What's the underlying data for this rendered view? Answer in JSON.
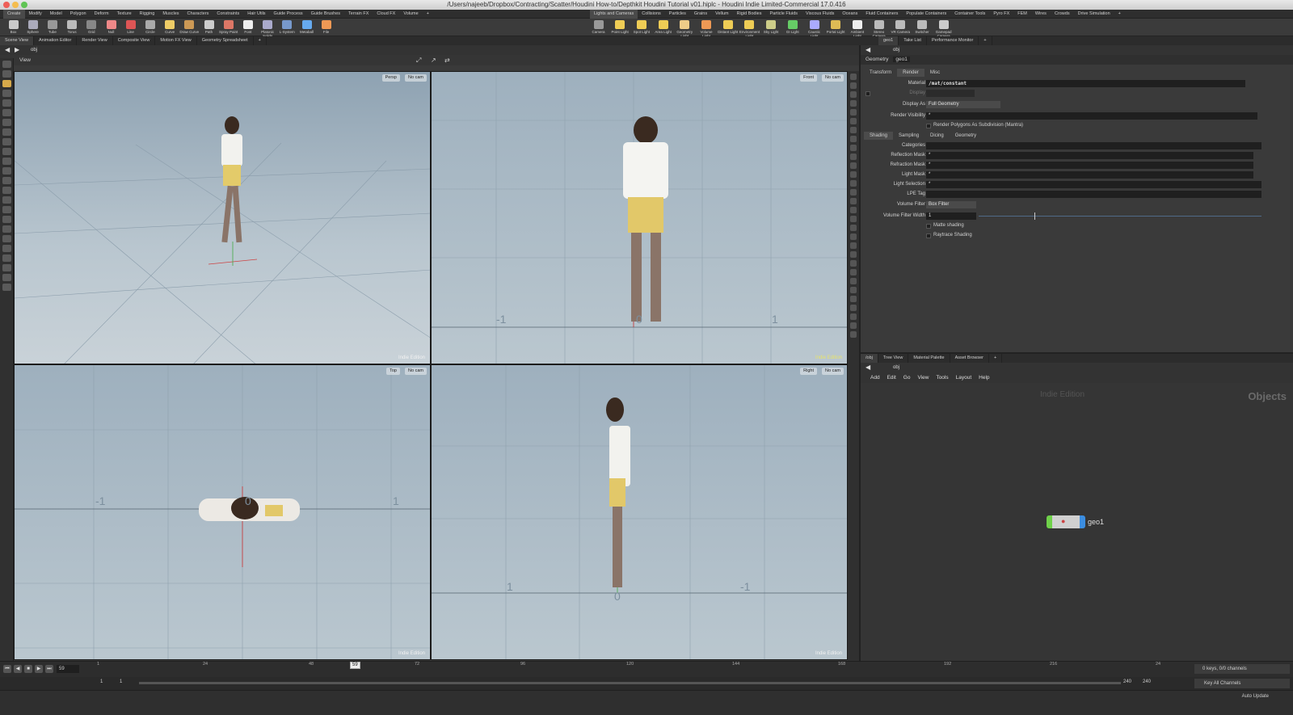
{
  "window": {
    "title": "/Users/najeeb/Dropbox/Contracting/Scatter/Houdini How-to/Depthkit Houdini Tutorial v01.hiplc - Houdini Indie Limited-Commercial 17.0.416"
  },
  "shelf_tabs_left": [
    "Create",
    "Modify",
    "Model",
    "Polygon",
    "Deform",
    "Texture",
    "Rigging",
    "Muscles",
    "Characters",
    "Constraints",
    "Hair Utils",
    "Guide Process",
    "Guide Brushes",
    "Terrain FX",
    "Cloud FX",
    "Volume",
    "+"
  ],
  "shelf_tabs_right": [
    "Lights and Cameras",
    "Collisions",
    "Particles",
    "Grains",
    "Vellum",
    "Rigid Bodies",
    "Particle Fluids",
    "Viscous Fluids",
    "Oceans",
    "Fluid Containers",
    "Populate Containers",
    "Container Tools",
    "Pyro FX",
    "FEM",
    "Wires",
    "Crowds",
    "Drive Simulation",
    "+"
  ],
  "shelf_tools_left": [
    "Box",
    "Sphere",
    "Tube",
    "Torus",
    "Grid",
    "Null",
    "Line",
    "Circle",
    "Curve",
    "Draw Curve",
    "Path",
    "Spray Paint",
    "Font",
    "Platonic Solids",
    "L-System",
    "Metaball",
    "File"
  ],
  "shelf_tools_right": [
    "Camera",
    "Point Light",
    "Spot Light",
    "Area Light",
    "Geometry Light",
    "Volume Light",
    "Distant Light",
    "Environment Light",
    "Sky Light",
    "GI Light",
    "Caustic Light",
    "Portal Light",
    "Ambient Light",
    "Stereo Camera",
    "VR Camera",
    "Switcher",
    "Gamepad Camera"
  ],
  "pane_tabs_left": [
    "Scene View",
    "Animation Editor",
    "Render View",
    "Composite View",
    "Motion FX View",
    "Geometry Spreadsheet",
    "+"
  ],
  "pane_tabs_right": [
    "geo1",
    "Take List",
    "Performance Monitor",
    "+"
  ],
  "scene_path": "obj",
  "view_label": "View",
  "viewports": {
    "persp": {
      "view": "Persp",
      "cam": "No cam",
      "edition": "Indie Edition"
    },
    "front": {
      "view": "Front",
      "cam": "No cam",
      "edition": "Indie Edition",
      "axis_labels": [
        "-1",
        "0",
        "1"
      ]
    },
    "top": {
      "view": "Top",
      "cam": "No cam",
      "edition": "Indie Edition",
      "axis_labels": [
        "-1",
        "0",
        "1"
      ]
    },
    "right": {
      "view": "Right",
      "cam": "No cam",
      "edition": "Indie Edition",
      "axis_labels": [
        "1",
        "0",
        "-1"
      ]
    }
  },
  "params": {
    "path": "obj",
    "node_type": "Geometry",
    "node_name": "geo1",
    "tabs": [
      "Transform",
      "Render",
      "Misc"
    ],
    "active_tab": "Render",
    "material_label": "Material",
    "material_value": "/mat/constant",
    "display_label": "Display",
    "display_as_label": "Display As",
    "display_as_value": "Full Geometry",
    "render_visibility_label": "Render Visibility",
    "render_visibility_value": "*",
    "render_polygons_label": "Render Polygons As Subdivision (Mantra)",
    "subtabs": [
      "Shading",
      "Sampling",
      "Dicing",
      "Geometry"
    ],
    "categories_label": "Categories",
    "reflection_mask_label": "Reflection Mask",
    "reflection_mask_value": "*",
    "refraction_mask_label": "Refraction Mask",
    "refraction_mask_value": "*",
    "light_mask_label": "Light Mask",
    "light_mask_value": "*",
    "light_selection_label": "Light Selection",
    "light_selection_value": "*",
    "lpe_tag_label": "LPE Tag",
    "volume_filter_label": "Volume Filter",
    "volume_filter_value": "Box Filter",
    "volume_filter_width_label": "Volume Filter Width",
    "volume_filter_width_value": "1",
    "matte_shading_label": "Matte shading",
    "raytrace_shading_label": "Raytrace Shading"
  },
  "network": {
    "tabs": [
      "/obj",
      "Tree View",
      "Material Palette",
      "Asset Browser",
      "+"
    ],
    "path": "obj",
    "menu": [
      "Add",
      "Edit",
      "Go",
      "View",
      "Tools",
      "Layout",
      "Help"
    ],
    "watermark": "Indie Edition",
    "context_label": "Objects",
    "node_name": "geo1"
  },
  "timeline": {
    "current_frame": "59",
    "frame_field": "59",
    "ticks": [
      "1",
      "24",
      "48",
      "72",
      "96",
      "120",
      "144",
      "168",
      "192",
      "216",
      "24"
    ],
    "start": "1",
    "start2": "1",
    "end": "240",
    "end2": "240"
  },
  "status": {
    "keys": "0 keys, 0/0 channels",
    "key_all": "Key All Channels",
    "auto_update": "Auto Update"
  }
}
